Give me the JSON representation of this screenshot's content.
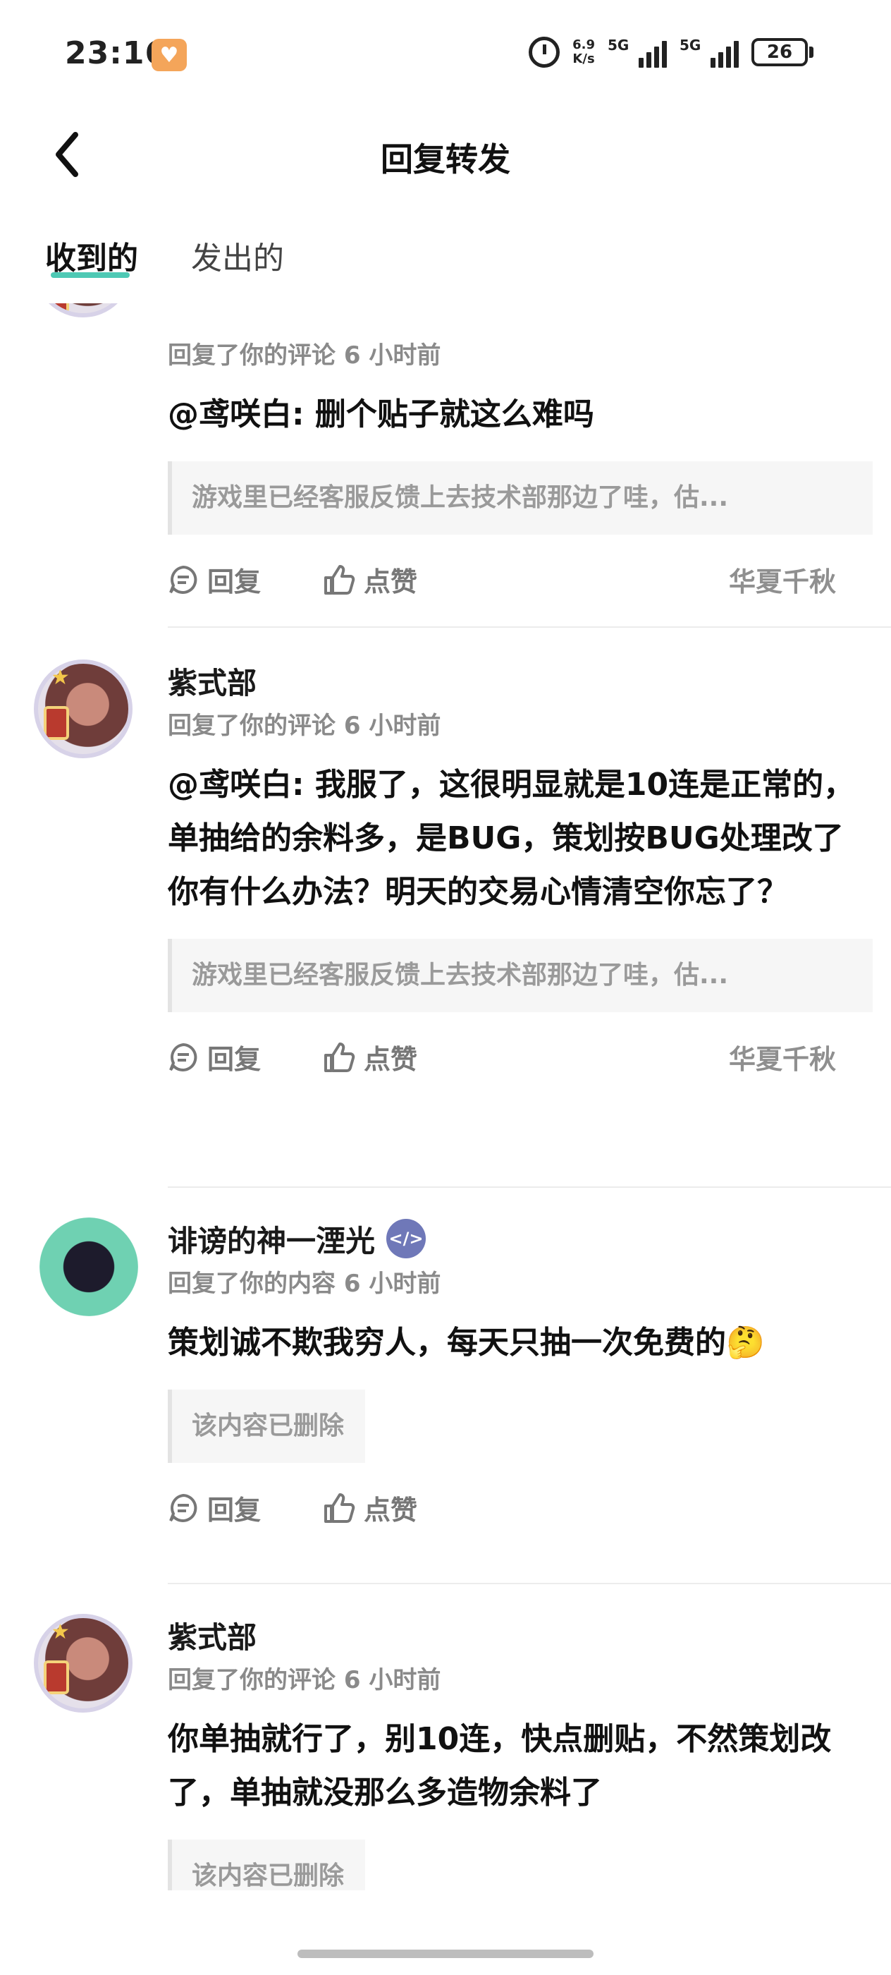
{
  "status_bar": {
    "time": "23:16",
    "net_speed_value": "6.9",
    "net_speed_unit": "K/s",
    "signal1_label": "5G",
    "signal2_label": "5G",
    "battery": "26"
  },
  "header": {
    "title": "回复转发"
  },
  "tabs": [
    {
      "label": "收到的",
      "active": true
    },
    {
      "label": "发出的",
      "active": false
    }
  ],
  "items": [
    {
      "username": "",
      "meta": "回复了你的评论 6 小时前",
      "text": "@鸢咲白: 删个贴子就这么难吗",
      "quote": "游戏里已经客服反馈上去技术部那边了哇，估...",
      "reply_label": "回复",
      "like_label": "点赞",
      "source": "华夏千秋"
    },
    {
      "username": "紫式部",
      "meta": "回复了你的评论 6 小时前",
      "text": "@鸢咲白: 我服了，这很明显就是10连是正常的，单抽给的余料多，是BUG，策划按BUG处理改了你有什么办法？明天的交易心情清空你忘了？",
      "quote": "游戏里已经客服反馈上去技术部那边了哇，估...",
      "reply_label": "回复",
      "like_label": "点赞",
      "source": "华夏千秋"
    },
    {
      "username": "诽谤的神一湮光",
      "meta": "回复了你的内容 6 小时前",
      "text": "策划诚不欺我穷人，每天只抽一次免费的🤔",
      "quote": "该内容已删除",
      "reply_label": "回复",
      "like_label": "点赞",
      "source": ""
    },
    {
      "username": "紫式部",
      "meta": "回复了你的评论 6 小时前",
      "text": "你单抽就行了，别10连，快点删贴，不然策划改了，单抽就没那么多造物余料了",
      "quote": "该内容已删除"
    }
  ]
}
